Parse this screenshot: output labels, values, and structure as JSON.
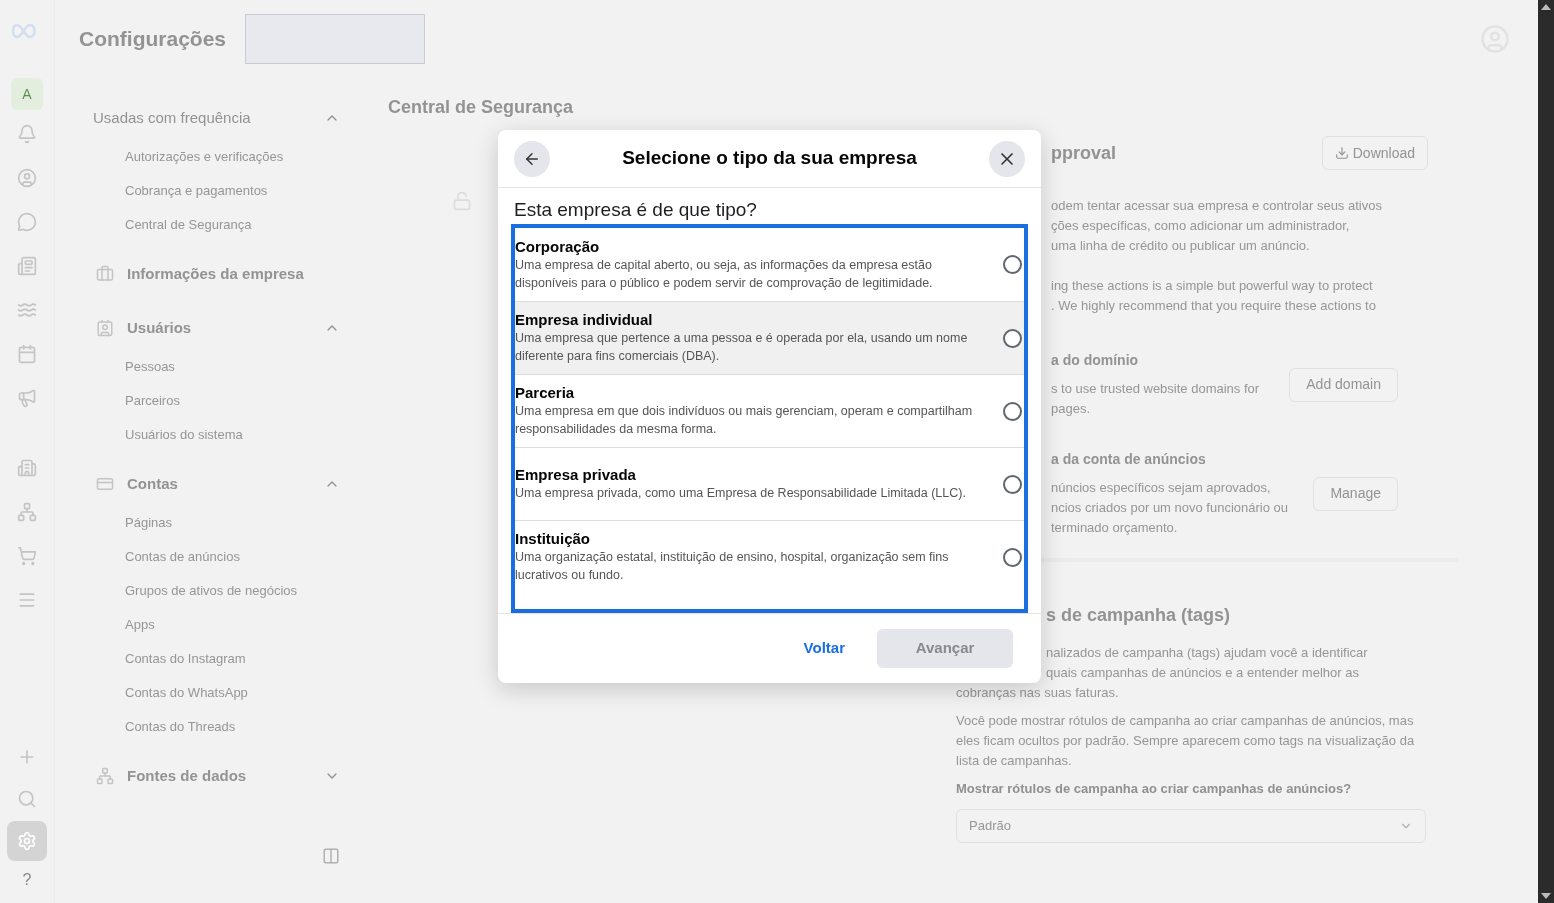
{
  "header": {
    "title": "Configurações"
  },
  "rail": {
    "avatar_letter": "A",
    "help_label": "?",
    "items": [
      {
        "selected": false
      },
      {
        "selected": false
      },
      {
        "selected": false
      },
      {
        "selected": false
      },
      {
        "selected": false
      },
      {
        "selected": false
      },
      {
        "selected": false
      },
      {
        "selected": false
      },
      {
        "selected": false
      },
      {
        "selected": false
      },
      {
        "selected": false
      },
      {
        "selected": false
      },
      {
        "selected": false
      },
      {
        "selected": true
      }
    ]
  },
  "sidebar": {
    "sections": [
      {
        "title": "Usadas com frequência",
        "expanded": true,
        "items": [
          "Autorizações e verificações",
          "Cobrança e pagamentos",
          "Central de Segurança"
        ]
      },
      {
        "title": "Informações da empresa"
      },
      {
        "title": "Usuários",
        "expanded": true,
        "items": [
          "Pessoas",
          "Parceiros",
          "Usuários do sistema"
        ]
      },
      {
        "title": "Contas",
        "expanded": true,
        "items": [
          "Páginas",
          "Contas de anúncios",
          "Grupos de ativos de negócios",
          "Apps",
          "Contas do Instagram",
          "Contas do WhatsApp",
          "Contas do Threads"
        ]
      },
      {
        "title": "Fontes de dados",
        "expanded": false
      }
    ]
  },
  "main": {
    "title": "Central de Segurança",
    "right_top": [
      {
        "kind": "heading",
        "text": "pproval",
        "button": "Download"
      },
      {
        "kind": "paragraph",
        "lines": [
          "odem tentar acessar sua empresa e controlar seus ativos",
          "ções específicas, como adicionar um administrador,",
          "uma linha de crédito ou publicar um anúncio."
        ]
      },
      {
        "kind": "paragraph",
        "lines": [
          "ing these actions is a simple but powerful way to protect",
          ". We highly recommend that you require these actions to"
        ]
      },
      {
        "kind": "setting",
        "text": "a do domínio",
        "lines": [
          "s to use trusted website domains for",
          "pages."
        ],
        "button": "Add domain"
      },
      {
        "kind": "setting",
        "text": "a da conta de anúncios",
        "lines": [
          "núncios específicos sejam aprovados,",
          "ncios criados por um novo funcionário ou",
          "terminado orçamento."
        ],
        "button": "Manage"
      }
    ],
    "tags_section": {
      "title": "s de campanha (tags)",
      "partial_lines": [
        "nalizados de campanha (tags) ajudam você a identificar",
        "quais campanhas de anúncios e a entender melhor as"
      ],
      "lines": [
        "cobranças nas suas faturas."
      ],
      "paragraph": "Você pode mostrar rótulos de campanha ao criar campanhas de anúncios, mas eles ficam ocultos por padrão. Sempre aparecem como tags na visualização da lista de campanhas.",
      "question": "Mostrar rótulos de campanha ao criar campanhas de anúncios?",
      "select": {
        "value": "Padrão"
      }
    }
  },
  "dialog": {
    "title": "Selecione o tipo da sua empresa",
    "question": "Esta empresa é de que tipo?",
    "options": [
      {
        "title": "Corporação",
        "description": "Uma empresa de capital aberto, ou seja, as informações da empresa estão disponíveis para o público e podem servir de comprovação de legitimidade.",
        "selected": false,
        "hovered": false
      },
      {
        "title": "Empresa individual",
        "description": "Uma empresa que pertence a uma pessoa e é operada por ela, usando um nome diferente para fins comerciais (DBA).",
        "selected": false,
        "hovered": true
      },
      {
        "title": "Parceria",
        "description": "Uma empresa em que dois indivíduos ou mais gerenciam, operam e compartilham responsabilidades da mesma forma.",
        "selected": false,
        "hovered": false
      },
      {
        "title": "Empresa privada",
        "description": "Uma empresa privada, como uma Empresa de Responsabilidade Limitada (LLC).",
        "selected": false,
        "hovered": false
      },
      {
        "title": "Instituição",
        "description": "Uma organização estatal, instituição de ensino, hospital, organização sem fins lucrativos ou fundo.",
        "selected": false,
        "hovered": false
      }
    ],
    "back_label": "Voltar",
    "next": {
      "label": "Avançar",
      "disabled": true
    }
  }
}
